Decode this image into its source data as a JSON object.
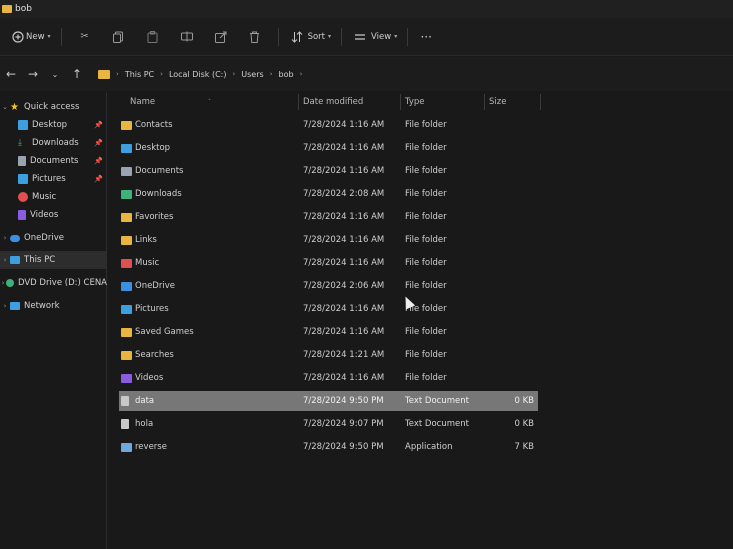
{
  "window": {
    "title": "bob"
  },
  "toolbar": {
    "new_label": "New",
    "sort_label": "Sort",
    "view_label": "View",
    "icons": [
      "cut-icon",
      "copy-icon",
      "paste-icon",
      "rename-icon",
      "share-icon",
      "delete-icon"
    ]
  },
  "address": {
    "crumbs": [
      "This PC",
      "Local Disk (C:)",
      "Users",
      "bob"
    ]
  },
  "sidebar": {
    "items": [
      {
        "label": "Quick access",
        "icon": "star-icon",
        "color": "#f2c230"
      },
      {
        "label": "Desktop",
        "icon": "desktop-icon",
        "color": "#3d9ee0",
        "pinned": true
      },
      {
        "label": "Downloads",
        "icon": "download-icon",
        "color": "#3bb37a",
        "pinned": true
      },
      {
        "label": "Documents",
        "icon": "document-icon",
        "color": "#9aa4b0",
        "pinned": true
      },
      {
        "label": "Pictures",
        "icon": "pictures-icon",
        "color": "#3d9ee0",
        "pinned": true
      },
      {
        "label": "Music",
        "icon": "music-icon",
        "color": "#e05050"
      },
      {
        "label": "Videos",
        "icon": "videos-icon",
        "color": "#8a5ce0"
      },
      {
        "label": "OneDrive",
        "icon": "cloud-icon",
        "color": "#3d8fe0"
      },
      {
        "label": "This PC",
        "icon": "pc-icon",
        "color": "#3d9ee0"
      },
      {
        "label": "DVD Drive (D:) CENA",
        "icon": "dvd-icon",
        "color": "#3bb37a"
      },
      {
        "label": "Network",
        "icon": "network-icon",
        "color": "#3d9ee0"
      }
    ]
  },
  "columns": {
    "name": "Name",
    "date": "Date modified",
    "type": "Type",
    "size": "Size"
  },
  "files": [
    {
      "name": "Contacts",
      "date": "7/28/2024 1:16 AM",
      "type": "File folder",
      "size": "",
      "icon": "folder-icon",
      "color": "#e8b640"
    },
    {
      "name": "Desktop",
      "date": "7/28/2024 1:16 AM",
      "type": "File folder",
      "size": "",
      "icon": "desktop-icon",
      "color": "#3d9ee0"
    },
    {
      "name": "Documents",
      "date": "7/28/2024 1:16 AM",
      "type": "File folder",
      "size": "",
      "icon": "document-icon",
      "color": "#9aa4b0"
    },
    {
      "name": "Downloads",
      "date": "7/28/2024 2:08 AM",
      "type": "File folder",
      "size": "",
      "icon": "download-icon",
      "color": "#3bb37a"
    },
    {
      "name": "Favorites",
      "date": "7/28/2024 1:16 AM",
      "type": "File folder",
      "size": "",
      "icon": "folder-icon",
      "color": "#e8b640"
    },
    {
      "name": "Links",
      "date": "7/28/2024 1:16 AM",
      "type": "File folder",
      "size": "",
      "icon": "folder-icon",
      "color": "#e8b640"
    },
    {
      "name": "Music",
      "date": "7/28/2024 1:16 AM",
      "type": "File folder",
      "size": "",
      "icon": "music-icon",
      "color": "#e05050"
    },
    {
      "name": "OneDrive",
      "date": "7/28/2024 2:06 AM",
      "type": "File folder",
      "size": "",
      "icon": "cloud-icon",
      "color": "#3d8fe0"
    },
    {
      "name": "Pictures",
      "date": "7/28/2024 1:16 AM",
      "type": "File folder",
      "size": "",
      "icon": "pictures-icon",
      "color": "#3d9ee0"
    },
    {
      "name": "Saved Games",
      "date": "7/28/2024 1:16 AM",
      "type": "File folder",
      "size": "",
      "icon": "folder-icon",
      "color": "#e8b640"
    },
    {
      "name": "Searches",
      "date": "7/28/2024 1:21 AM",
      "type": "File folder",
      "size": "",
      "icon": "folder-icon",
      "color": "#e8b640"
    },
    {
      "name": "Videos",
      "date": "7/28/2024 1:16 AM",
      "type": "File folder",
      "size": "",
      "icon": "videos-icon",
      "color": "#8a5ce0"
    },
    {
      "name": "data",
      "date": "7/28/2024 9:50 PM",
      "type": "Text Document",
      "size": "0 KB",
      "icon": "text-file-icon",
      "color": "#c8c8c8",
      "selected": true
    },
    {
      "name": "hola",
      "date": "7/28/2024 9:07 PM",
      "type": "Text Document",
      "size": "0 KB",
      "icon": "text-file-icon",
      "color": "#c8c8c8"
    },
    {
      "name": "reverse",
      "date": "7/28/2024 9:50 PM",
      "type": "Application",
      "size": "7 KB",
      "icon": "app-icon",
      "color": "#6fa8dc"
    }
  ]
}
